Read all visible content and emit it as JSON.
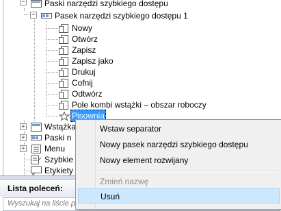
{
  "tree": {
    "toolbars_root": "Paski narzędzi szybkiego dostępu",
    "toolbar_1": "Pasek narzędzi szybkiego dostępu 1",
    "commands": [
      "Nowy",
      "Otwórz",
      "Zapisz",
      "Zapisz jako",
      "Drukuj",
      "Cofnij",
      "Odtwórz",
      "Pole kombi wstążki – obszar roboczy"
    ],
    "selected_command": "Pisownia",
    "lower_items": [
      "Wstążka",
      "Paski n",
      "Menu",
      "Szybkie w",
      "Etykiety k"
    ]
  },
  "context_menu": {
    "items": [
      {
        "label": "Wstaw separator",
        "enabled": true
      },
      {
        "label": "Nowy pasek narzędzi szybkiego dostępu",
        "enabled": true
      },
      {
        "label": "Nowy element rozwijany",
        "enabled": true
      },
      {
        "label": "Zmień nazwę",
        "enabled": false
      },
      {
        "label": "Usuń",
        "enabled": true,
        "highlighted": true
      }
    ]
  },
  "panel": {
    "title": "Lista poleceń:",
    "search_placeholder": "Wyszukaj na liście poleceń"
  },
  "colors": {
    "selection": "#3399ff",
    "menu_highlight": "#cce8ff",
    "menu_background": "#f0f0f0"
  }
}
